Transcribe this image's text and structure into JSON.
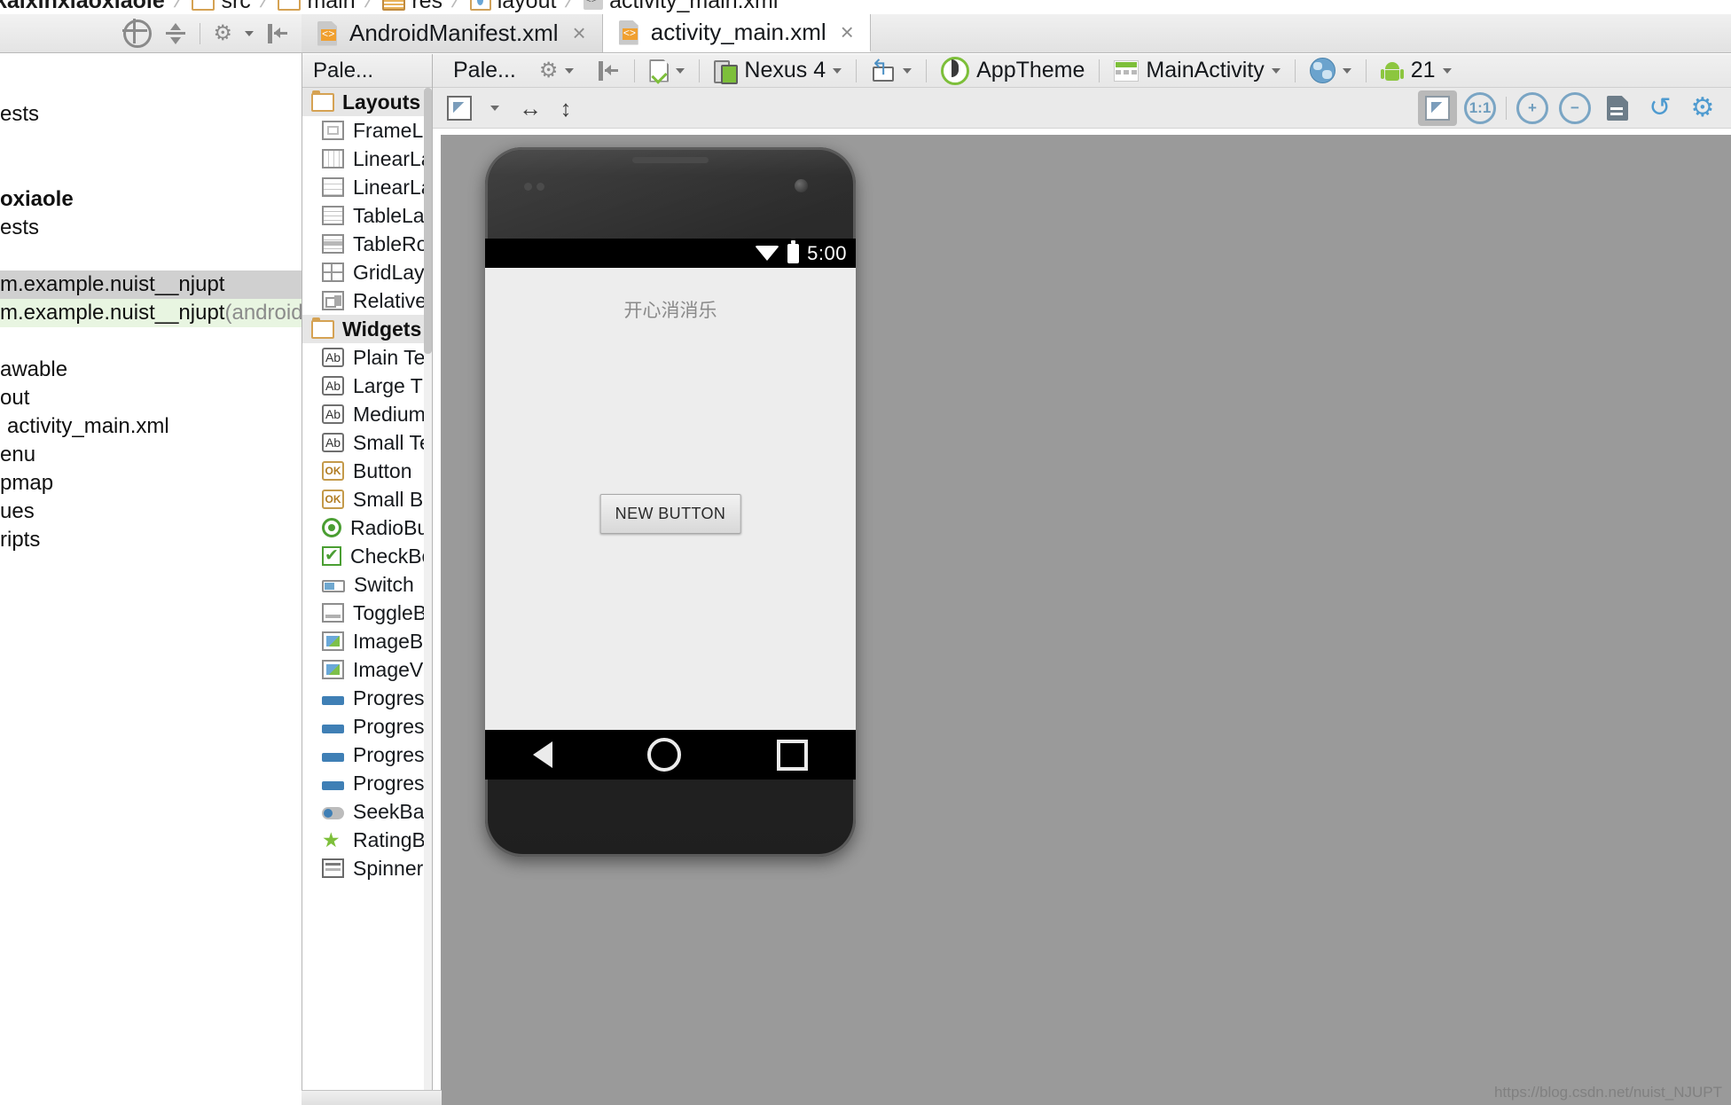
{
  "breadcrumb": {
    "items": [
      {
        "label": "kaixinxiaoxiaole",
        "icon": "module-icon"
      },
      {
        "label": "src",
        "icon": "folder-icon"
      },
      {
        "label": "main",
        "icon": "folder-icon"
      },
      {
        "label": "res",
        "icon": "res-folder-icon"
      },
      {
        "label": "layout",
        "icon": "layout-folder-icon"
      },
      {
        "label": "activity_main.xml",
        "icon": "xml-file-icon"
      }
    ],
    "separator": "/"
  },
  "project_tree": {
    "toolbar": {
      "locate_title": "Select Opened File",
      "collapse_title": "Collapse All",
      "settings_title": "Settings",
      "hide_title": "Hide"
    },
    "rows": [
      {
        "label": "ests",
        "indent": 0,
        "state": "normal"
      },
      {
        "label": "oxiaole",
        "indent": 0,
        "state": "bold"
      },
      {
        "label": "ests",
        "indent": 0,
        "state": "normal"
      },
      {
        "label": "m.example.nuist__njupt",
        "indent": 0,
        "state": "selected"
      },
      {
        "label": "m.example.nuist__njupt",
        "suffix": " (androidTest)",
        "indent": 0,
        "state": "green"
      },
      {
        "label": "awable",
        "indent": 0,
        "state": "normal"
      },
      {
        "label": "out",
        "indent": 0,
        "state": "normal"
      },
      {
        "label": "activity_main.xml",
        "indent": 1,
        "state": "normal"
      },
      {
        "label": "enu",
        "indent": 0,
        "state": "normal"
      },
      {
        "label": "pmap",
        "indent": 0,
        "state": "normal"
      },
      {
        "label": "ues",
        "indent": 0,
        "state": "normal"
      },
      {
        "label": "ripts",
        "indent": 0,
        "state": "normal"
      }
    ]
  },
  "editor_tabs": [
    {
      "label": "AndroidManifest.xml",
      "close": "×",
      "active": false,
      "icon": "xml-file-icon"
    },
    {
      "label": "activity_main.xml",
      "close": "×",
      "active": true,
      "icon": "xml-file-icon"
    }
  ],
  "palette": {
    "header": "Pale...",
    "groups": [
      {
        "label": "Layouts",
        "icon": "folder-icon",
        "items": [
          {
            "label": "FrameLa",
            "icon": "framelayout-icon"
          },
          {
            "label": "LinearLa",
            "icon": "linearlayout-horizontal-icon"
          },
          {
            "label": "LinearLa",
            "icon": "linearlayout-vertical-icon"
          },
          {
            "label": "TableLa",
            "icon": "tablelayout-icon"
          },
          {
            "label": "TableRo",
            "icon": "tablerow-icon"
          },
          {
            "label": "GridLay",
            "icon": "gridlayout-icon"
          },
          {
            "label": "Relative",
            "icon": "relativelayout-icon"
          }
        ]
      },
      {
        "label": "Widgets",
        "icon": "folder-icon",
        "items": [
          {
            "label": "Plain Te",
            "icon": "text-ab-icon"
          },
          {
            "label": "Large T",
            "icon": "text-ab-icon"
          },
          {
            "label": "Medium",
            "icon": "text-ab-icon"
          },
          {
            "label": "Small Te",
            "icon": "text-ab-icon"
          },
          {
            "label": "Button",
            "icon": "button-ok-icon"
          },
          {
            "label": "Small Bu",
            "icon": "button-ok-icon"
          },
          {
            "label": "RadioBu",
            "icon": "radiobutton-icon"
          },
          {
            "label": "CheckBo",
            "icon": "checkbox-icon"
          },
          {
            "label": "Switch",
            "icon": "switch-icon"
          },
          {
            "label": "ToggleB",
            "icon": "togglebutton-icon"
          },
          {
            "label": "ImageB",
            "icon": "imagebutton-icon"
          },
          {
            "label": "ImageV",
            "icon": "imageview-icon"
          },
          {
            "label": "Progres",
            "icon": "progressbar-icon"
          },
          {
            "label": "Progres",
            "icon": "progressbar-icon"
          },
          {
            "label": "Progres",
            "icon": "progressbar-icon"
          },
          {
            "label": "Progres",
            "icon": "progressbar-icon"
          },
          {
            "label": "SeekBar",
            "icon": "seekbar-icon"
          },
          {
            "label": "RatingB",
            "icon": "ratingbar-star-icon"
          },
          {
            "label": "Spinner",
            "icon": "spinner-icon"
          }
        ]
      }
    ]
  },
  "design_toolbar": {
    "config_icon": "gear-icon",
    "hide_icon": "hide-panel-icon",
    "new_variation_label": "",
    "device": "Nexus 4",
    "orientation_label": "",
    "theme": "AppTheme",
    "activity": "MainActivity",
    "locale_label": "",
    "api_level": "21",
    "dropdown_caret": "▾"
  },
  "design_toolbar2": {
    "expand_title": "Expand",
    "fit_width_icon": "↔",
    "fit_height_icon": "↕",
    "zoom_controls": [
      {
        "name": "zoom-to-fit",
        "label": "",
        "selected": true
      },
      {
        "name": "zoom-actual-size",
        "label": "1:1",
        "selected": false
      },
      {
        "name": "zoom-in",
        "label": "+",
        "selected": false
      },
      {
        "name": "zoom-out",
        "label": "−",
        "selected": false
      },
      {
        "name": "screenshot",
        "label": "",
        "selected": false
      },
      {
        "name": "refresh",
        "label": "↺",
        "selected": false
      },
      {
        "name": "preview-settings",
        "label": "",
        "selected": false
      }
    ]
  },
  "preview": {
    "device_name": "Nexus 4",
    "status_bar": {
      "time": "5:00",
      "wifi_icon": "wifi-icon",
      "battery_icon": "battery-icon"
    },
    "app_text": "开心消消乐",
    "button_label": "NEW BUTTON",
    "nav_bar": {
      "back": "back-triangle-icon",
      "home": "home-circle-icon",
      "recents": "recents-square-icon"
    },
    "background_color": "#ededed",
    "canvas_color": "#9a9a9a"
  },
  "watermark": "https://blog.csdn.net/nuist_NJUPT"
}
